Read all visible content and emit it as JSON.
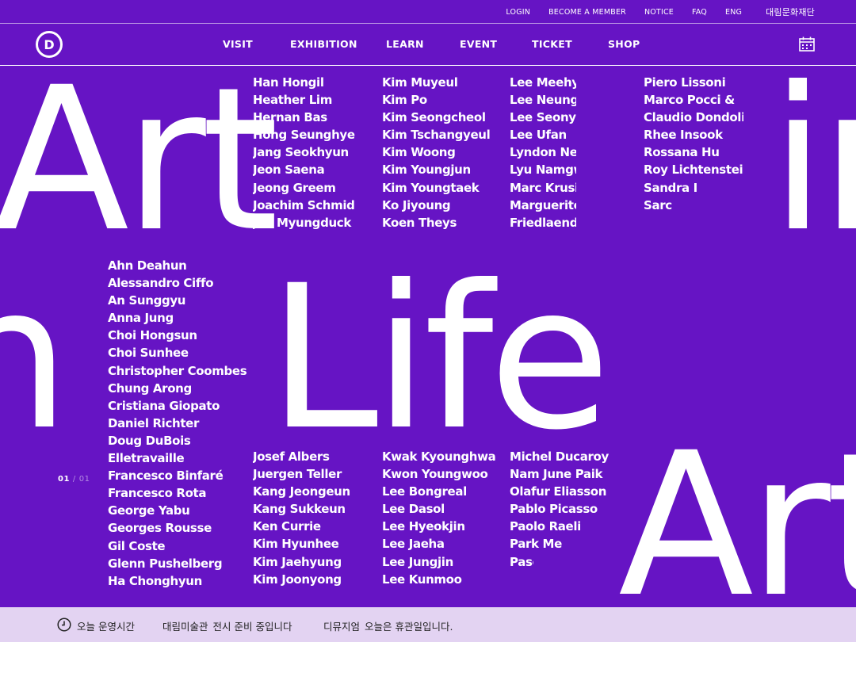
{
  "utility_links": [
    "LOGIN",
    "BECOME A MEMBER",
    "NOTICE",
    "FAQ",
    "ENG",
    "대림문화재단"
  ],
  "logo_letter": "D",
  "nav": [
    "VISIT",
    "EXHIBITION",
    "LEARN",
    "EVENT",
    "TICKET",
    "SHOP"
  ],
  "hero": {
    "big_text": [
      "Art",
      "in",
      "n",
      "Life",
      "Art"
    ],
    "name_columns_top": [
      [
        "Han Hongil",
        "Heather Lim",
        "Hernan Bas",
        "Hong Seunghye",
        "Jang Seokhyun",
        "Jeon Saena",
        "Jeong Greem",
        "Joachim Schmid",
        "Joo Myungduck"
      ],
      [
        "Kim Muyeul",
        "Kim Po",
        "Kim Seongcheol",
        "Kim Tschangyeul",
        "Kim Woong",
        "Kim Youngjun",
        "Kim Youngtaek",
        "Ko Jiyoung",
        "Koen Theys"
      ],
      [
        "Lee Meehye",
        "Lee Neungho",
        "Lee Seonyong",
        "Lee Ufan",
        "Lyndon Neri",
        "Lyu Namgwon",
        "Marc Krusin",
        "Marguerite",
        "Friedlaender"
      ],
      [
        "Piero Lissoni",
        "Marco Pocci &",
        "Claudio Dondoli",
        "Rhee Insook",
        "Rossana Hu",
        "Roy Lichtenstein",
        "Sandra I",
        "Sarc"
      ]
    ],
    "name_columns_bottom": [
      [
        "Ahn Deahun",
        "Alessandro Ciffo",
        "An Sunggyu",
        "Anna Jung",
        "Choi Hongsun",
        "Choi Sunhee",
        "Christopher Coombes",
        "Chung Arong",
        "Cristiana Giopato",
        "Daniel Richter",
        "Doug DuBois",
        "Elletravaille",
        "Francesco Binfaré",
        "Francesco Rota",
        "George Yabu",
        "Georges Rousse",
        "Gil Coste",
        "Glenn Pushelberg",
        "Ha Chonghyun"
      ],
      [
        "Josef Albers",
        "Juergen Teller",
        "Kang Jeongeun",
        "Kang Sukkeun",
        "Ken Currie",
        "Kim Hyunhee",
        "Kim Jaehyung",
        "Kim Joonyong"
      ],
      [
        "Kwak Kyounghwa",
        "Kwon Youngwoo",
        "Lee Bongreal",
        "Lee Dasol",
        "Lee Hyeokjin",
        "Lee Jaeha",
        "Lee Jungjin",
        "Lee Kunmoo"
      ],
      [
        "Michel Ducaroy",
        "Nam June Paik",
        "Olafur Eliasson",
        "Pablo Picasso",
        "Paolo Raeli",
        "Park Me",
        "Pasc"
      ]
    ],
    "pager": {
      "current": "01",
      "separator": "/",
      "total": "01"
    }
  },
  "status_bar": {
    "label": "오늘 운영시간",
    "museum1_name": "대림미술관",
    "museum1_status": "전시 준비 중입니다",
    "museum2_name": "디뮤지엄",
    "museum2_status": "오늘은 휴관일입니다."
  },
  "colors": {
    "brand_purple": "#6614c4",
    "status_bg": "#e3d3f2"
  },
  "icons": [
    "calendar-icon",
    "clock-icon"
  ]
}
